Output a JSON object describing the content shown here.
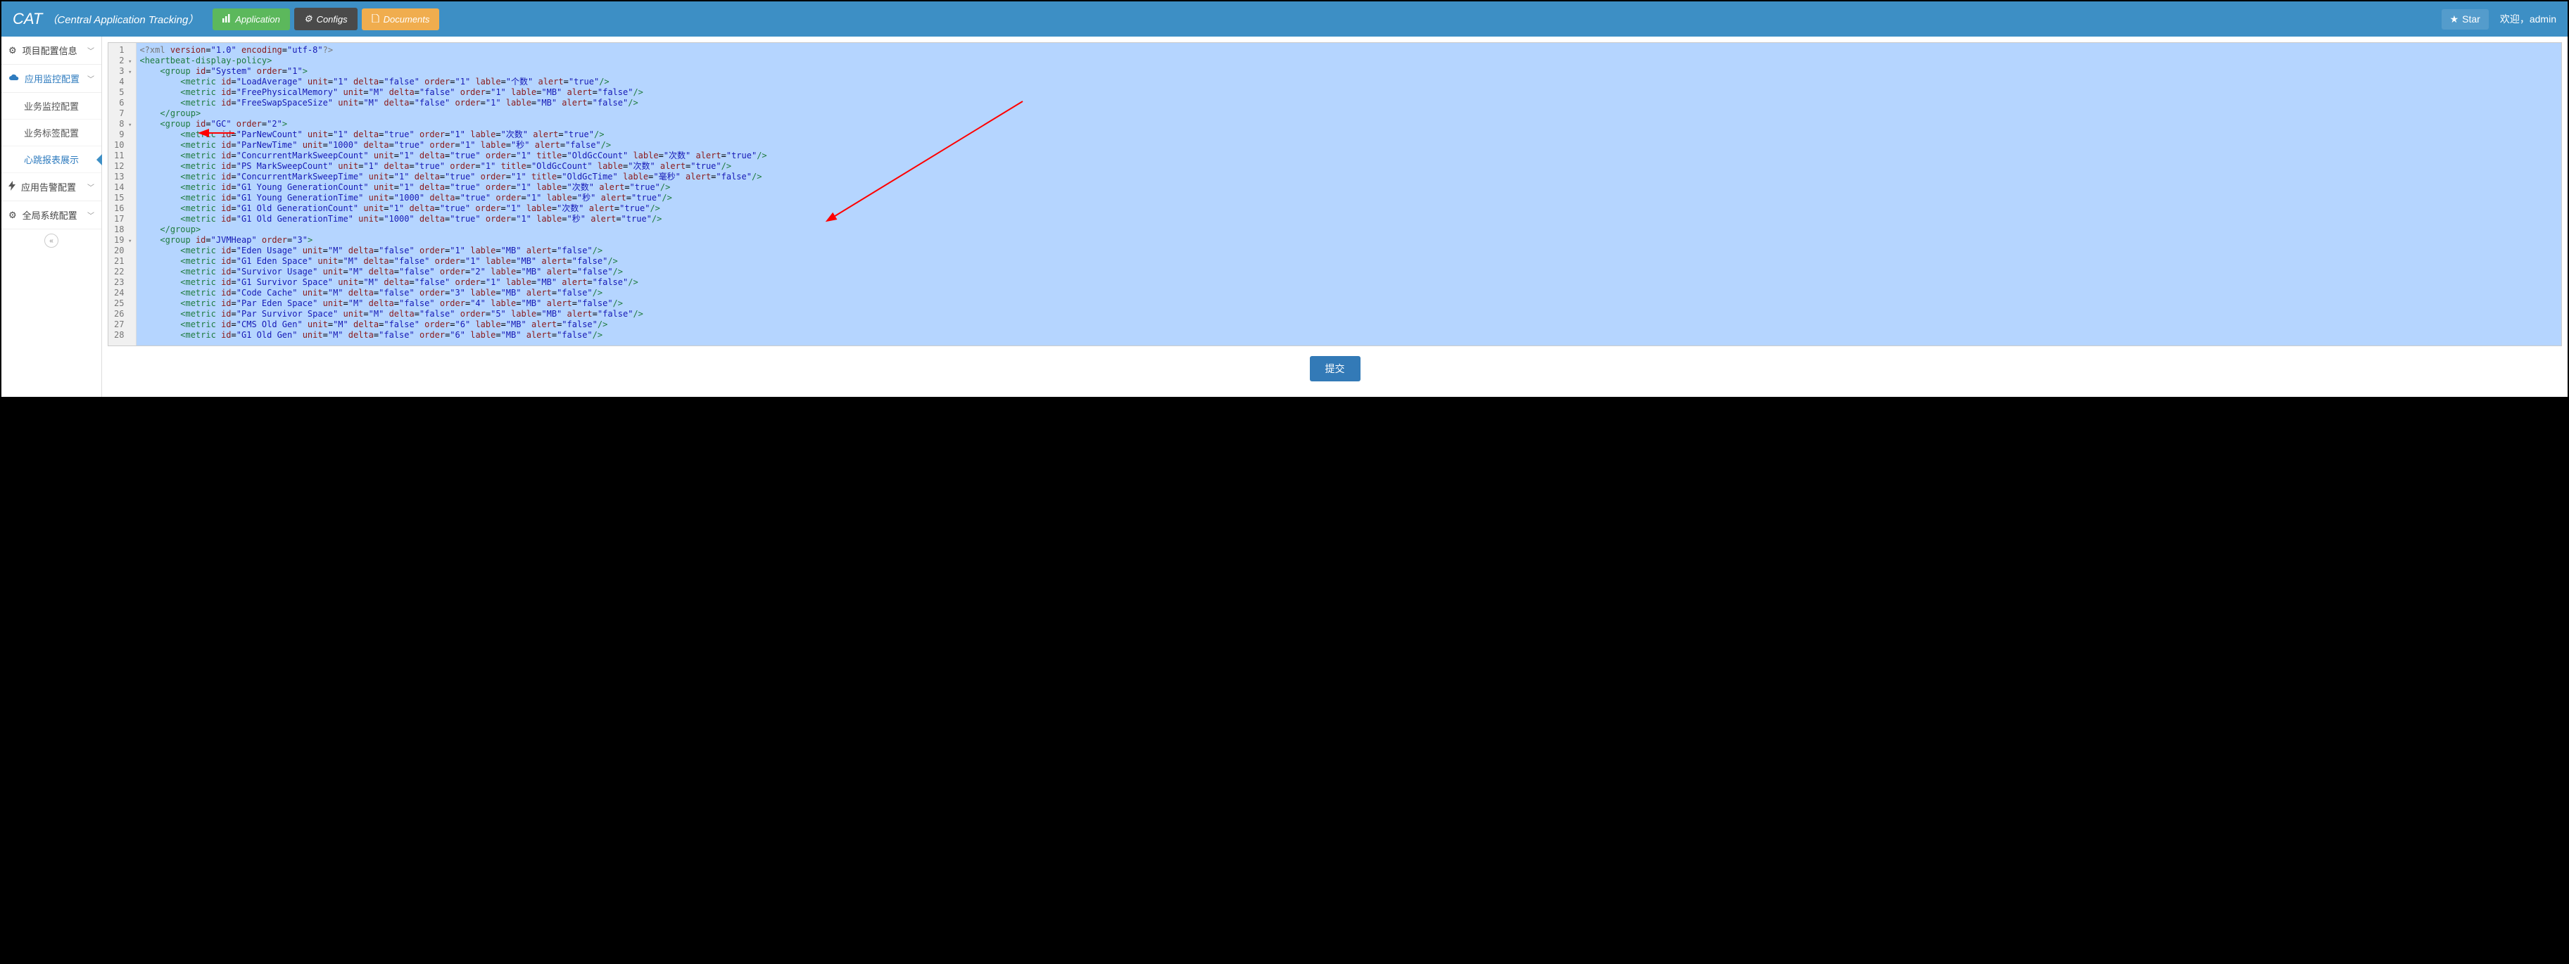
{
  "header": {
    "brand": "CAT",
    "brand_sub": "（Central Application Tracking）",
    "nav_app": "Application",
    "nav_cfg": "Configs",
    "nav_doc": "Documents",
    "star": "Star",
    "welcome": "欢迎，admin"
  },
  "sidebar": {
    "group1": "项目配置信息",
    "group2": "应用监控配置",
    "sub1": "业务监控配置",
    "sub2": "业务标签配置",
    "sub3": "心跳报表展示",
    "group3": "应用告警配置",
    "group4": "全局系统配置"
  },
  "submit": "提交",
  "code": {
    "lines": [
      {
        "n": 1,
        "raw": "<?xml version=\"1.0\" encoding=\"utf-8\"?>",
        "type": "pi"
      },
      {
        "n": 2,
        "fold": true,
        "indent": 0,
        "tag": "heartbeat-display-policy",
        "open": true
      },
      {
        "n": 3,
        "fold": true,
        "indent": 1,
        "tag": "group",
        "open": true,
        "attrs": [
          [
            "id",
            "System"
          ],
          [
            "order",
            "1"
          ]
        ]
      },
      {
        "n": 4,
        "indent": 2,
        "tag": "metric",
        "self": true,
        "attrs": [
          [
            "id",
            "LoadAverage"
          ],
          [
            "unit",
            "1"
          ],
          [
            "delta",
            "false"
          ],
          [
            "order",
            "1"
          ],
          [
            "lable",
            "个数"
          ],
          [
            "alert",
            "true"
          ]
        ]
      },
      {
        "n": 5,
        "indent": 2,
        "tag": "metric",
        "self": true,
        "attrs": [
          [
            "id",
            "FreePhysicalMemory"
          ],
          [
            "unit",
            "M"
          ],
          [
            "delta",
            "false"
          ],
          [
            "order",
            "1"
          ],
          [
            "lable",
            "MB"
          ],
          [
            "alert",
            "false"
          ]
        ]
      },
      {
        "n": 6,
        "indent": 2,
        "tag": "metric",
        "self": true,
        "attrs": [
          [
            "id",
            "FreeSwapSpaceSize"
          ],
          [
            "unit",
            "M"
          ],
          [
            "delta",
            "false"
          ],
          [
            "order",
            "1"
          ],
          [
            "lable",
            "MB"
          ],
          [
            "alert",
            "false"
          ]
        ]
      },
      {
        "n": 7,
        "indent": 1,
        "tag": "group",
        "close": true
      },
      {
        "n": 8,
        "fold": true,
        "indent": 1,
        "tag": "group",
        "open": true,
        "attrs": [
          [
            "id",
            "GC"
          ],
          [
            "order",
            "2"
          ]
        ]
      },
      {
        "n": 9,
        "indent": 2,
        "tag": "metric",
        "self": true,
        "attrs": [
          [
            "id",
            "ParNewCount"
          ],
          [
            "unit",
            "1"
          ],
          [
            "delta",
            "true"
          ],
          [
            "order",
            "1"
          ],
          [
            "lable",
            "次数"
          ],
          [
            "alert",
            "true"
          ]
        ]
      },
      {
        "n": 10,
        "indent": 2,
        "tag": "metric",
        "self": true,
        "attrs": [
          [
            "id",
            "ParNewTime"
          ],
          [
            "unit",
            "1000"
          ],
          [
            "delta",
            "true"
          ],
          [
            "order",
            "1"
          ],
          [
            "lable",
            "秒"
          ],
          [
            "alert",
            "false"
          ]
        ]
      },
      {
        "n": 11,
        "indent": 2,
        "tag": "metric",
        "self": true,
        "attrs": [
          [
            "id",
            "ConcurrentMarkSweepCount"
          ],
          [
            "unit",
            "1"
          ],
          [
            "delta",
            "true"
          ],
          [
            "order",
            "1"
          ],
          [
            "title",
            "OldGcCount"
          ],
          [
            "lable",
            "次数"
          ],
          [
            "alert",
            "true"
          ]
        ]
      },
      {
        "n": 12,
        "indent": 2,
        "tag": "metric",
        "self": true,
        "attrs": [
          [
            "id",
            "PS MarkSweepCount"
          ],
          [
            "unit",
            "1"
          ],
          [
            "delta",
            "true"
          ],
          [
            "order",
            "1"
          ],
          [
            "title",
            "OldGcCount"
          ],
          [
            "lable",
            "次数"
          ],
          [
            "alert",
            "true"
          ]
        ]
      },
      {
        "n": 13,
        "indent": 2,
        "tag": "metric",
        "self": true,
        "attrs": [
          [
            "id",
            "ConcurrentMarkSweepTime"
          ],
          [
            "unit",
            "1"
          ],
          [
            "delta",
            "true"
          ],
          [
            "order",
            "1"
          ],
          [
            "title",
            "OldGcTime"
          ],
          [
            "lable",
            "毫秒"
          ],
          [
            "alert",
            "false"
          ]
        ]
      },
      {
        "n": 14,
        "indent": 2,
        "tag": "metric",
        "self": true,
        "attrs": [
          [
            "id",
            "G1 Young GenerationCount"
          ],
          [
            "unit",
            "1"
          ],
          [
            "delta",
            "true"
          ],
          [
            "order",
            "1"
          ],
          [
            "lable",
            "次数"
          ],
          [
            "alert",
            "true"
          ]
        ]
      },
      {
        "n": 15,
        "indent": 2,
        "tag": "metric",
        "self": true,
        "attrs": [
          [
            "id",
            "G1 Young GenerationTime"
          ],
          [
            "unit",
            "1000"
          ],
          [
            "delta",
            "true"
          ],
          [
            "order",
            "1"
          ],
          [
            "lable",
            "秒"
          ],
          [
            "alert",
            "true"
          ]
        ]
      },
      {
        "n": 16,
        "indent": 2,
        "tag": "metric",
        "self": true,
        "attrs": [
          [
            "id",
            "G1 Old GenerationCount"
          ],
          [
            "unit",
            "1"
          ],
          [
            "delta",
            "true"
          ],
          [
            "order",
            "1"
          ],
          [
            "lable",
            "次数"
          ],
          [
            "alert",
            "true"
          ]
        ]
      },
      {
        "n": 17,
        "indent": 2,
        "tag": "metric",
        "self": true,
        "attrs": [
          [
            "id",
            "G1 Old GenerationTime"
          ],
          [
            "unit",
            "1000"
          ],
          [
            "delta",
            "true"
          ],
          [
            "order",
            "1"
          ],
          [
            "lable",
            "秒"
          ],
          [
            "alert",
            "true"
          ]
        ]
      },
      {
        "n": 18,
        "indent": 1,
        "tag": "group",
        "close": true
      },
      {
        "n": 19,
        "fold": true,
        "indent": 1,
        "tag": "group",
        "open": true,
        "attrs": [
          [
            "id",
            "JVMHeap"
          ],
          [
            "order",
            "3"
          ]
        ]
      },
      {
        "n": 20,
        "indent": 2,
        "tag": "metric",
        "self": true,
        "attrs": [
          [
            "id",
            "Eden Usage"
          ],
          [
            "unit",
            "M"
          ],
          [
            "delta",
            "false"
          ],
          [
            "order",
            "1"
          ],
          [
            "lable",
            "MB"
          ],
          [
            "alert",
            "false"
          ]
        ]
      },
      {
        "n": 21,
        "indent": 2,
        "tag": "metric",
        "self": true,
        "attrs": [
          [
            "id",
            "G1 Eden Space"
          ],
          [
            "unit",
            "M"
          ],
          [
            "delta",
            "false"
          ],
          [
            "order",
            "1"
          ],
          [
            "lable",
            "MB"
          ],
          [
            "alert",
            "false"
          ]
        ]
      },
      {
        "n": 22,
        "indent": 2,
        "tag": "metric",
        "self": true,
        "attrs": [
          [
            "id",
            "Survivor Usage"
          ],
          [
            "unit",
            "M"
          ],
          [
            "delta",
            "false"
          ],
          [
            "order",
            "2"
          ],
          [
            "lable",
            "MB"
          ],
          [
            "alert",
            "false"
          ]
        ]
      },
      {
        "n": 23,
        "indent": 2,
        "tag": "metric",
        "self": true,
        "attrs": [
          [
            "id",
            "G1 Survivor Space"
          ],
          [
            "unit",
            "M"
          ],
          [
            "delta",
            "false"
          ],
          [
            "order",
            "1"
          ],
          [
            "lable",
            "MB"
          ],
          [
            "alert",
            "false"
          ]
        ]
      },
      {
        "n": 24,
        "indent": 2,
        "tag": "metric",
        "self": true,
        "attrs": [
          [
            "id",
            "Code Cache"
          ],
          [
            "unit",
            "M"
          ],
          [
            "delta",
            "false"
          ],
          [
            "order",
            "3"
          ],
          [
            "lable",
            "MB"
          ],
          [
            "alert",
            "false"
          ]
        ]
      },
      {
        "n": 25,
        "indent": 2,
        "tag": "metric",
        "self": true,
        "attrs": [
          [
            "id",
            "Par Eden Space"
          ],
          [
            "unit",
            "M"
          ],
          [
            "delta",
            "false"
          ],
          [
            "order",
            "4"
          ],
          [
            "lable",
            "MB"
          ],
          [
            "alert",
            "false"
          ]
        ]
      },
      {
        "n": 26,
        "indent": 2,
        "tag": "metric",
        "self": true,
        "attrs": [
          [
            "id",
            "Par Survivor Space"
          ],
          [
            "unit",
            "M"
          ],
          [
            "delta",
            "false"
          ],
          [
            "order",
            "5"
          ],
          [
            "lable",
            "MB"
          ],
          [
            "alert",
            "false"
          ]
        ]
      },
      {
        "n": 27,
        "indent": 2,
        "tag": "metric",
        "self": true,
        "attrs": [
          [
            "id",
            "CMS Old Gen"
          ],
          [
            "unit",
            "M"
          ],
          [
            "delta",
            "false"
          ],
          [
            "order",
            "6"
          ],
          [
            "lable",
            "MB"
          ],
          [
            "alert",
            "false"
          ]
        ]
      },
      {
        "n": 28,
        "indent": 2,
        "tag": "metric",
        "self": true,
        "attrs": [
          [
            "id",
            "G1 Old Gen"
          ],
          [
            "unit",
            "M"
          ],
          [
            "delta",
            "false"
          ],
          [
            "order",
            "6"
          ],
          [
            "lable",
            "MB"
          ],
          [
            "alert",
            "false"
          ]
        ]
      }
    ]
  }
}
